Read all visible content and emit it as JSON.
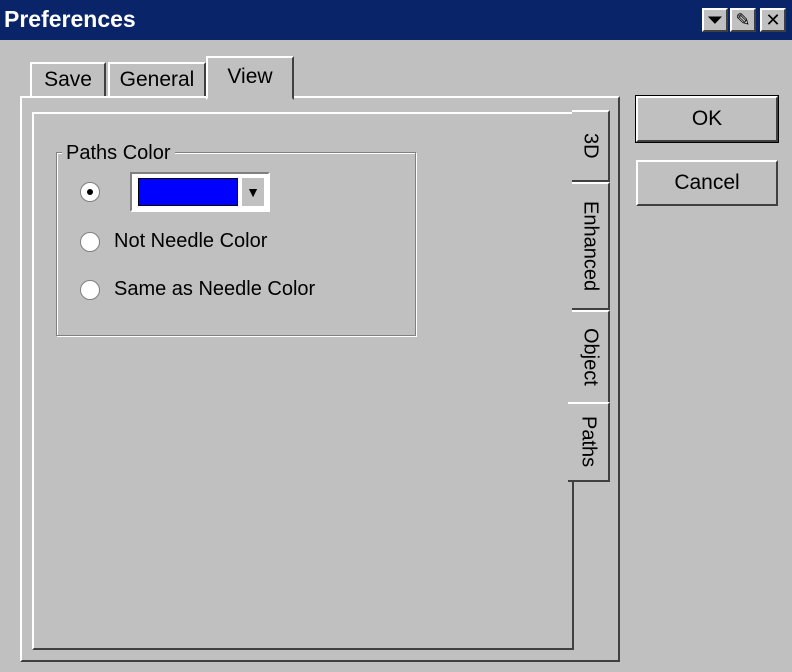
{
  "window": {
    "title": "Preferences"
  },
  "titlebar_buttons": [
    {
      "name": "minimize",
      "glyph": "⏷"
    },
    {
      "name": "help",
      "glyph": "✎"
    },
    {
      "name": "close",
      "glyph": "✕"
    }
  ],
  "tabs": [
    {
      "label": "Save",
      "selected": false
    },
    {
      "label": "General",
      "selected": false
    },
    {
      "label": "View",
      "selected": true
    }
  ],
  "side_tabs": [
    {
      "label": "3D",
      "selected": false
    },
    {
      "label": "Enhanced",
      "selected": false
    },
    {
      "label": "Object",
      "selected": false
    },
    {
      "label": "Paths",
      "selected": true
    }
  ],
  "paths_color": {
    "group_label": "Paths Color",
    "selected_color": "#0000ff",
    "options": [
      {
        "label": "",
        "selected": true
      },
      {
        "label": "Not Needle Color",
        "selected": false
      },
      {
        "label": "Same as Needle Color",
        "selected": false
      }
    ]
  },
  "buttons": {
    "ok": "OK",
    "cancel": "Cancel"
  },
  "colors": {
    "titlebar": "#0a246a",
    "face": "#c0c0c0",
    "swatch": "#0000ff"
  }
}
